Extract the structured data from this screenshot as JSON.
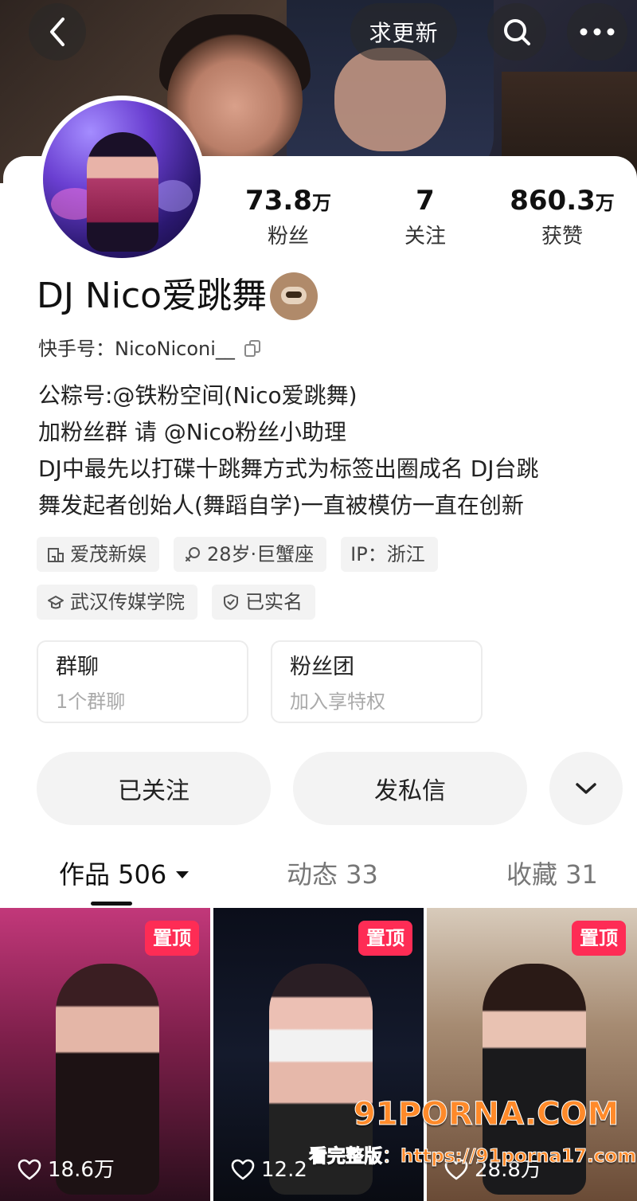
{
  "header": {
    "refresh_label": "求更新"
  },
  "stats": [
    {
      "value": "73.8",
      "unit": "万",
      "label": "粉丝"
    },
    {
      "value": "7",
      "unit": "",
      "label": "关注"
    },
    {
      "value": "860.3",
      "unit": "万",
      "label": "获赞"
    }
  ],
  "profile": {
    "name": "DJ Nico爱跳舞",
    "kuaishou_id": "快手号：NicoNiconi__",
    "bio": [
      "公粽号:@铁粉空间(Nico爱跳舞)",
      "加粉丝群 请 @Nico粉丝小助理",
      "DJ中最先以打碟十跳舞方式为标签出圈成名 DJ台跳",
      "舞发起者创始人(舞蹈自学)一直被模仿一直在创新"
    ]
  },
  "tags": [
    {
      "icon": "building-icon",
      "label": "爱茂新娱"
    },
    {
      "icon": "gender-icon",
      "label": "28岁·巨蟹座"
    },
    {
      "icon": "",
      "label": "IP：浙江"
    },
    {
      "icon": "graduation-cap-icon",
      "label": "武汉传媒学院"
    },
    {
      "icon": "shield-check-icon",
      "label": "已实名"
    }
  ],
  "boxes": [
    {
      "title": "群聊",
      "sub": "1个群聊"
    },
    {
      "title": "粉丝团",
      "sub": "加入享特权"
    }
  ],
  "actions": {
    "follow_label": "已关注",
    "message_label": "发私信"
  },
  "tabs": [
    {
      "label": "作品 506"
    },
    {
      "label": "动态 33"
    },
    {
      "label": "收藏 31"
    }
  ],
  "videos": [
    {
      "pin": "置顶",
      "likes": "18.6万"
    },
    {
      "pin": "置顶",
      "likes": "12.2"
    },
    {
      "pin": "置顶",
      "likes": "28.8万"
    }
  ],
  "watermark": {
    "logo": "91PORNA.COM",
    "url": "看完整版：https://91porna17.com"
  },
  "colors": {
    "accent": "#fe2c55",
    "tag_bg": "#f3f3f3",
    "button_bg": "#f3f3f3"
  }
}
